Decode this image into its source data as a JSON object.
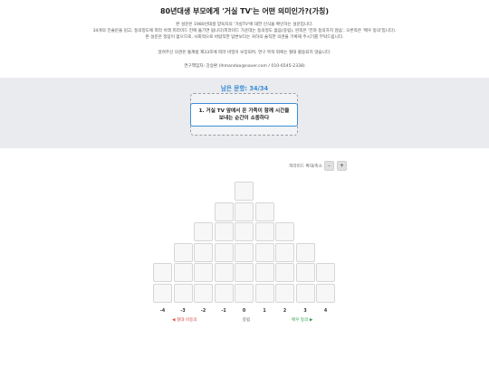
{
  "survey": {
    "title": "80년대생 부모에게 '거실 TV'는 어떤 의미인가?(가칭)",
    "desc": [
      "본 설문은 1980년대생 양육자의 '거실TV'에 대한 인식을 확인하는 설문입니다.",
      "34개의 진술문을 읽고, 동의정도에 따라 아래 피라미드 칸에 옮기면 됩니다(피라미드 가운데는 동의정도 없음(중립), 왼쪽은 '전혀 동의하지 않음', 오른쪽은 '매우 동의'입니다).",
      "본 설문은 정답이 없으므로, 사회적으로 바람직한 답변보다는 귀하의 솔직한 의견을 기록해 주시기를 부탁드립니다.",
      "알려주신 의견은 통계법 제33조에 따라 비밀이 보장되며, 연구 목적 외에는 절대 활용되지 않습니다.",
      "연구책임자: 강승환 (lhmandoo@naver.com / 010-6545-2338)"
    ]
  },
  "sort_area": {
    "remaining_label": "남은 문항: 34/34",
    "current_card": [
      "1. 거실 TV 앞에서 온 가족이 함께 시간을",
      "보내는 순간이 소중하다"
    ]
  },
  "font_control": {
    "label": "피라미드 확대/축소",
    "minus": "-",
    "plus": "+"
  },
  "pyramid": {
    "scores": [
      "-4",
      "-3",
      "-2",
      "-1",
      "0",
      "1",
      "2",
      "3",
      "4"
    ],
    "column_heights": [
      2,
      3,
      4,
      5,
      6,
      5,
      4,
      3,
      2
    ],
    "anchor_left": "◀ 절대 비동의",
    "anchor_mid": "중립",
    "anchor_right": "매우 동의 ▶"
  }
}
